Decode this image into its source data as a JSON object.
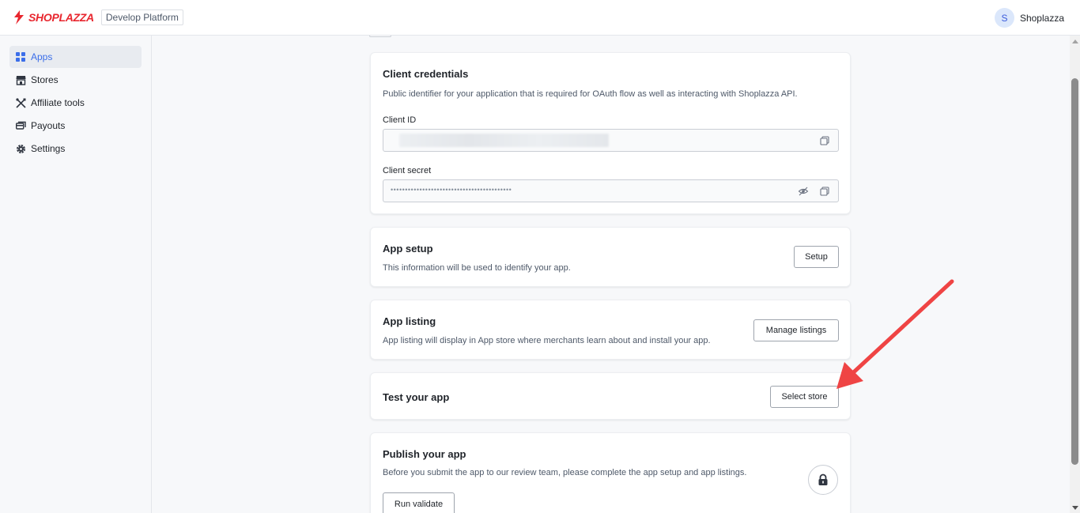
{
  "header": {
    "logo_text": "SHOPLAZZA",
    "platform_tag": "Develop Platform",
    "user_initial": "S",
    "user_name": "Shoplazza"
  },
  "sidebar": {
    "items": [
      {
        "label": "Apps",
        "icon": "grid-icon",
        "active": true
      },
      {
        "label": "Stores",
        "icon": "store-icon",
        "active": false
      },
      {
        "label": "Affiliate tools",
        "icon": "tools-icon",
        "active": false
      },
      {
        "label": "Payouts",
        "icon": "payouts-icon",
        "active": false
      },
      {
        "label": "Settings",
        "icon": "gear-icon",
        "active": false
      }
    ]
  },
  "credentials": {
    "title": "Client credentials",
    "description": "Public identifier for your application that is required for OAuth flow as well as interacting with Shoplazza API.",
    "client_id_label": "Client ID",
    "client_secret_label": "Client secret",
    "client_secret_masked": "••••••••••••••••••••••••••••••••••••••••••"
  },
  "app_setup": {
    "title": "App setup",
    "description": "This information will be used to identify your app.",
    "button": "Setup"
  },
  "app_listing": {
    "title": "App listing",
    "description": "App listing will display in App store where merchants learn about and install your app.",
    "button": "Manage listings"
  },
  "test_app": {
    "title": "Test your app",
    "button": "Select store"
  },
  "publish": {
    "title": "Publish your app",
    "description": "Before you submit the app to our review team, please complete the app setup and app listings.",
    "button": "Run validate"
  },
  "colors": {
    "brand": "#e8262e",
    "accent": "#3b6ee9",
    "annotation_arrow": "#ef4444"
  }
}
